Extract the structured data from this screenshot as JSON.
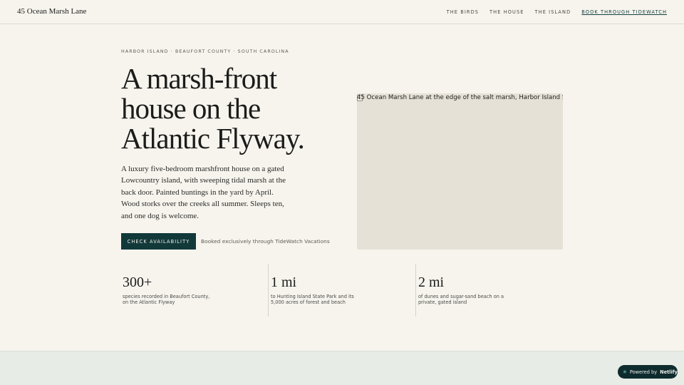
{
  "header": {
    "brand": "45 Ocean Marsh Lane",
    "nav": [
      "THE BIRDS",
      "THE HOUSE",
      "THE ISLAND",
      "BOOK THROUGH TIDEWATCH"
    ]
  },
  "hero": {
    "eyebrow": "HARBOR ISLAND · BEAUFORT COUNTY · SOUTH CAROLINA",
    "headline": "A marsh-front house on the Atlantic Flyway.",
    "intro": "A luxury five-bedroom marshfront house on a gated Lowcountry island, with sweeping tidal marsh at the back door. Painted buntings in the yard by April. Wood storks over the creeks all summer. Sleeps ten, and one dog is welcome.",
    "cta_label": "CHECK AVAILABILITY",
    "cta_note": "Booked exclusively through TideWatch Vacations",
    "image_alt": "45 Ocean Marsh Lane at the edge of the salt marsh, Harbor Island SC"
  },
  "stats": [
    {
      "value": "300+",
      "desc": "species recorded in Beaufort County, on the Atlantic Flyway"
    },
    {
      "value": "1 mi",
      "desc": "to Hunting Island State Park and its 5,000 acres of forest and beach"
    },
    {
      "value": "2 mi",
      "desc": "of dunes and sugar-sand beach on a private, gated island"
    }
  ],
  "badge": {
    "prefix": "Powered by",
    "brand": "Netlify",
    "icon": "netlify-spark-icon"
  },
  "colors": {
    "background": "#f7f4ee",
    "accent": "#12393a",
    "image_placeholder": "#e5e1d6",
    "bottom_band": "#e8ece6"
  }
}
